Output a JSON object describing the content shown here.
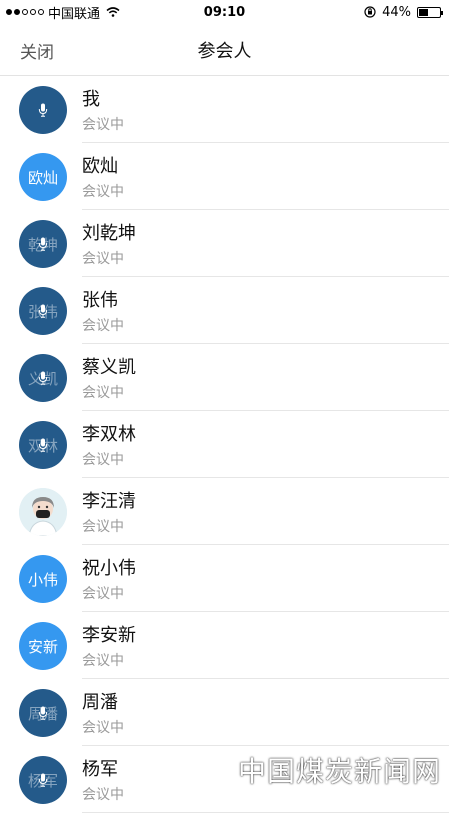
{
  "status_bar": {
    "carrier": "中国联通",
    "time": "09:10",
    "battery": "44%",
    "battery_level": 0.44
  },
  "nav": {
    "close_label": "关闭",
    "title": "参会人"
  },
  "participants": [
    {
      "name": "我",
      "status": "会议中",
      "avatar_text": "",
      "avatar_style": "dark-mic"
    },
    {
      "name": "欧灿",
      "status": "会议中",
      "avatar_text": "欧灿",
      "avatar_style": "blue"
    },
    {
      "name": "刘乾坤",
      "status": "会议中",
      "avatar_text": "乾坤",
      "avatar_style": "dark-mic"
    },
    {
      "name": "张伟",
      "status": "会议中",
      "avatar_text": "张伟",
      "avatar_style": "dark-mic"
    },
    {
      "name": "蔡义凯",
      "status": "会议中",
      "avatar_text": "义凯",
      "avatar_style": "dark-mic"
    },
    {
      "name": "李双林",
      "status": "会议中",
      "avatar_text": "双林",
      "avatar_style": "dark-mic"
    },
    {
      "name": "李汪清",
      "status": "会议中",
      "avatar_text": "",
      "avatar_style": "photo"
    },
    {
      "name": "祝小伟",
      "status": "会议中",
      "avatar_text": "小伟",
      "avatar_style": "blue"
    },
    {
      "name": "李安新",
      "status": "会议中",
      "avatar_text": "安新",
      "avatar_style": "blue"
    },
    {
      "name": "周潘",
      "status": "会议中",
      "avatar_text": "周潘",
      "avatar_style": "dark-mic"
    },
    {
      "name": "杨军",
      "status": "会议中",
      "avatar_text": "杨军",
      "avatar_style": "dark-mic"
    }
  ],
  "watermark": "中国煤炭新闻网",
  "colors": {
    "avatar_dark": "#245a8a",
    "avatar_blue": "#3598f0",
    "status_text": "#9a9a9a"
  }
}
